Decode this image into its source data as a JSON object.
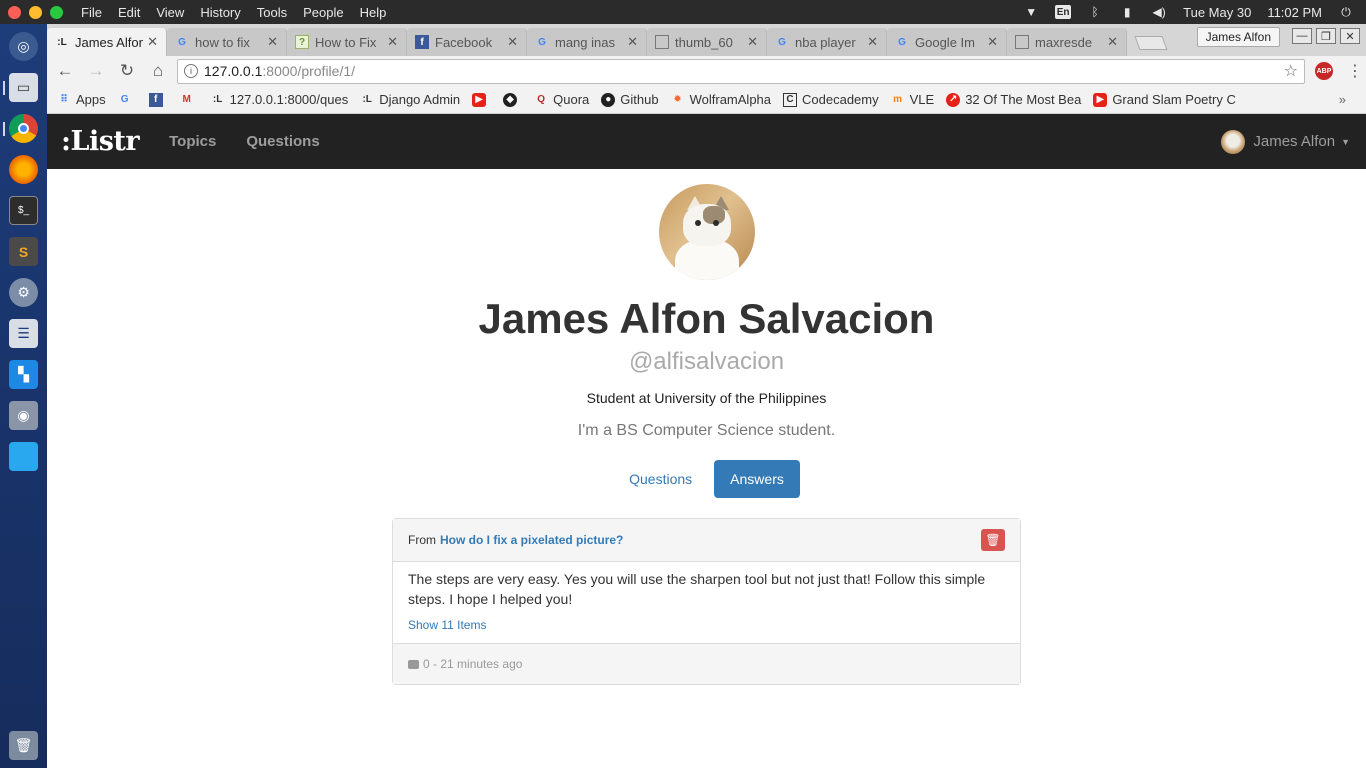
{
  "os": {
    "menu": [
      "File",
      "Edit",
      "View",
      "History",
      "Tools",
      "People",
      "Help"
    ],
    "lang": "En",
    "date": "Tue May 30",
    "time": "11:02 PM"
  },
  "browser": {
    "tabs": [
      {
        "label": "James Alfon",
        "icon": "listr-favicon",
        "active": true
      },
      {
        "label": "how to fix",
        "icon": "google-icon",
        "active": false
      },
      {
        "label": "How to Fix",
        "icon": "question-icon",
        "active": false
      },
      {
        "label": "Facebook",
        "icon": "facebook-icon",
        "active": false
      },
      {
        "label": "mang inas",
        "icon": "google-icon",
        "active": false
      },
      {
        "label": "thumb_60",
        "icon": "page-icon",
        "active": false
      },
      {
        "label": "nba player",
        "icon": "google-icon",
        "active": false
      },
      {
        "label": "Google Im",
        "icon": "google-icon",
        "active": false
      },
      {
        "label": "maxresde",
        "icon": "page-icon",
        "active": false
      }
    ],
    "profile_name": "James Alfon",
    "url_host": "127.0.0.1",
    "url_path": ":8000/profile/1/",
    "bookmarks": [
      {
        "label": "Apps",
        "icon": "apps-grid-icon"
      },
      {
        "label": "",
        "icon": "google-icon"
      },
      {
        "label": "",
        "icon": "facebook-icon"
      },
      {
        "label": "",
        "icon": "gmail-icon"
      },
      {
        "label": "127.0.0.1:8000/ques",
        "icon": "listr-favicon"
      },
      {
        "label": "Django Admin",
        "icon": "listr-favicon"
      },
      {
        "label": "",
        "icon": "youtube-icon"
      },
      {
        "label": "",
        "icon": "codepen-icon"
      },
      {
        "label": "Quora",
        "icon": "quora-icon"
      },
      {
        "label": "Github",
        "icon": "github-icon"
      },
      {
        "label": "WolframAlpha",
        "icon": "wolfram-icon"
      },
      {
        "label": "Codecademy",
        "icon": "codecademy-icon"
      },
      {
        "label": "VLE",
        "icon": "moodle-icon"
      },
      {
        "label": "32 Of The Most Bea",
        "icon": "trending-icon"
      },
      {
        "label": "Grand Slam Poetry C",
        "icon": "youtube-icon"
      }
    ]
  },
  "site": {
    "brand": ":Listr",
    "nav": {
      "topics": "Topics",
      "questions": "Questions"
    },
    "user_menu": "James Alfon"
  },
  "profile": {
    "full_name": "James Alfon Salvacion",
    "username": "@alfisalvacion",
    "headline": "Student at University of the Philippines",
    "bio": "I'm a BS Computer Science student.",
    "tabs": {
      "questions": "Questions",
      "answers": "Answers"
    }
  },
  "answer": {
    "from_label": "From",
    "question_title": "How do I fix a pixelated picture?",
    "body": "The steps are very easy. Yes you will use the sharpen tool but not just that! Follow this simple steps. I hope I helped you!",
    "show_items": "Show 11 Items",
    "comment_count": "0",
    "time_ago": "- 21 minutes ago"
  }
}
